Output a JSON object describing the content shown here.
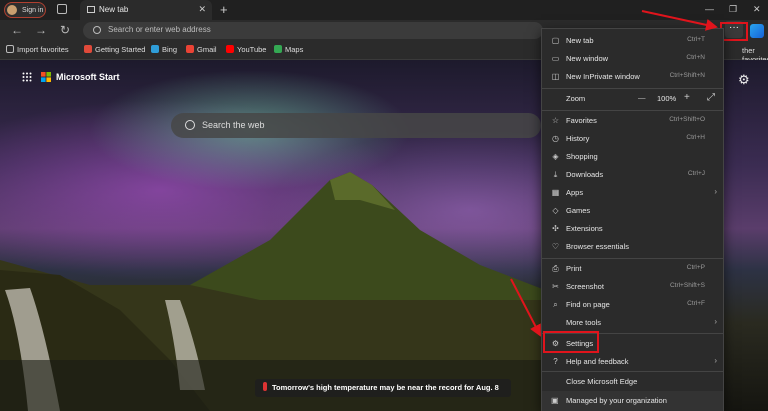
{
  "window": {
    "signin_label": "Sign in",
    "tab_title": "New tab",
    "new_tab_symbol": "+",
    "close_tab_symbol": "✕",
    "minimize_symbol": "—",
    "restore_symbol": "❐",
    "close_symbol": "✕"
  },
  "toolbar": {
    "back_symbol": "←",
    "forward_symbol": "→",
    "refresh_symbol": "↻",
    "address_placeholder": "Search or enter web address",
    "more_symbol": "···"
  },
  "favorites_bar": {
    "items": [
      {
        "label": "Import favorites",
        "color": "#bbbbbb"
      },
      {
        "label": "Getting Started",
        "color": "#e04a3a"
      },
      {
        "label": "Bing",
        "color": "#2f9dd8"
      },
      {
        "label": "Gmail",
        "color": "#ea4335"
      },
      {
        "label": "YouTube",
        "color": "#ff0000"
      },
      {
        "label": "Maps",
        "color": "#34a853"
      }
    ],
    "other_favorites": "ther favorites"
  },
  "page": {
    "brand": "Microsoft Start",
    "search_placeholder": "Search the web",
    "weather_text": "Tomorrow's high temperature may be near the record for Aug. 8"
  },
  "menu": {
    "items": [
      {
        "label": "New tab",
        "shortcut": "Ctrl+T",
        "icon": "new-tab-icon",
        "glyph": "▢"
      },
      {
        "label": "New window",
        "shortcut": "Ctrl+N",
        "icon": "window-icon",
        "glyph": "▭"
      },
      {
        "label": "New InPrivate window",
        "shortcut": "Ctrl+Shift+N",
        "icon": "inprivate-icon",
        "glyph": "◫"
      },
      {
        "label": "Favorites",
        "shortcut": "Ctrl+Shift+O",
        "icon": "star-icon",
        "glyph": "☆"
      },
      {
        "label": "History",
        "shortcut": "Ctrl+H",
        "icon": "history-icon",
        "glyph": "◷"
      },
      {
        "label": "Shopping",
        "shortcut": "",
        "icon": "shopping-icon",
        "glyph": "◈"
      },
      {
        "label": "Downloads",
        "shortcut": "Ctrl+J",
        "icon": "download-icon",
        "glyph": "⤓"
      },
      {
        "label": "Apps",
        "shortcut": "",
        "icon": "apps-icon",
        "glyph": "▦"
      },
      {
        "label": "Games",
        "shortcut": "",
        "icon": "games-icon",
        "glyph": "◇"
      },
      {
        "label": "Extensions",
        "shortcut": "",
        "icon": "extensions-icon",
        "glyph": "✣"
      },
      {
        "label": "Browser essentials",
        "shortcut": "",
        "icon": "heart-icon",
        "glyph": "♡"
      },
      {
        "label": "Print",
        "shortcut": "Ctrl+P",
        "icon": "print-icon",
        "glyph": "⎙"
      },
      {
        "label": "Screenshot",
        "shortcut": "Ctrl+Shift+S",
        "icon": "screenshot-icon",
        "glyph": "✂"
      },
      {
        "label": "Find on page",
        "shortcut": "Ctrl+F",
        "icon": "find-icon",
        "glyph": "⌕"
      },
      {
        "label": "More tools",
        "shortcut": "",
        "icon": "more-tools-icon",
        "glyph": ""
      },
      {
        "label": "Settings",
        "shortcut": "",
        "icon": "gear-icon",
        "glyph": "⚙"
      },
      {
        "label": "Help and feedback",
        "shortcut": "",
        "icon": "help-icon",
        "glyph": "?"
      },
      {
        "label": "Close Microsoft Edge",
        "shortcut": "",
        "icon": "close-icon",
        "glyph": ""
      },
      {
        "label": "Managed by your organization",
        "shortcut": "",
        "icon": "briefcase-icon",
        "glyph": "▣"
      }
    ],
    "zoom": {
      "label": "Zoom",
      "minus": "—",
      "value": "100%",
      "plus": "+",
      "fullscreen": "⤢"
    },
    "submenu_arrow": "›"
  },
  "colors": {
    "highlight_box": "#e0141c",
    "arrow": "#e0141c"
  }
}
